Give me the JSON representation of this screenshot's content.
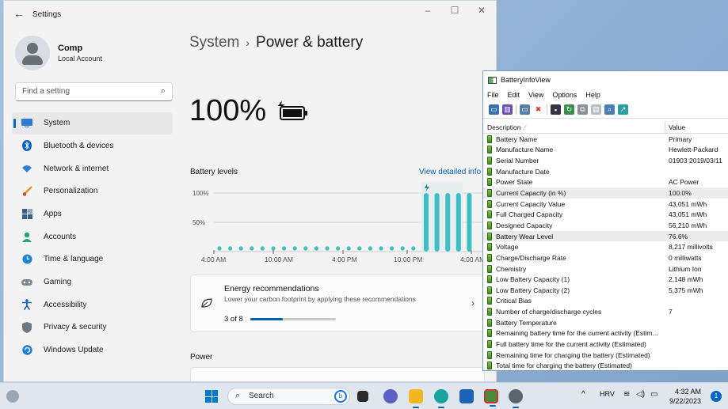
{
  "settings": {
    "window_title": "Settings",
    "profile": {
      "name": "Comp",
      "subtitle": "Local Account"
    },
    "search_placeholder": "Find a setting",
    "nav": [
      {
        "label": "System",
        "icon": "monitor-icon",
        "active": true
      },
      {
        "label": "Bluetooth & devices",
        "icon": "bluetooth-icon"
      },
      {
        "label": "Network & internet",
        "icon": "wifi-icon"
      },
      {
        "label": "Personalization",
        "icon": "brush-icon"
      },
      {
        "label": "Apps",
        "icon": "apps-icon"
      },
      {
        "label": "Accounts",
        "icon": "person-icon"
      },
      {
        "label": "Time & language",
        "icon": "globe-clock-icon"
      },
      {
        "label": "Gaming",
        "icon": "gamepad-icon"
      },
      {
        "label": "Accessibility",
        "icon": "accessibility-icon"
      },
      {
        "label": "Privacy & security",
        "icon": "shield-icon"
      },
      {
        "label": "Windows Update",
        "icon": "update-icon"
      }
    ],
    "breadcrumb": {
      "parent": "System",
      "sep": "›",
      "current": "Power & battery"
    },
    "battery_percent": "100%",
    "battery_levels_label": "Battery levels",
    "view_detailed_info": "View detailed info",
    "energy_card": {
      "title": "Energy recommendations",
      "subtitle": "Lower your carbon footprint by applying these recommendations",
      "count": "3 of 8",
      "progress": 0.375
    },
    "power_label": "Power"
  },
  "chart_data": {
    "type": "bar",
    "y_ticks": [
      "100%",
      "50%"
    ],
    "x_labels": [
      "4:00 AM",
      "10:00 AM",
      "4:00 PM",
      "10:00 PM",
      "4:00 AM"
    ],
    "series": [
      {
        "values": [
          100,
          100,
          100,
          100,
          100
        ]
      }
    ],
    "ylim": [
      0,
      100
    ]
  },
  "biv": {
    "title": "BatteryInfoView",
    "menu": [
      "File",
      "Edit",
      "View",
      "Options",
      "Help"
    ],
    "col_description": "Description",
    "col_value": "Value",
    "rows": [
      {
        "d": "Battery Name",
        "v": "Primary"
      },
      {
        "d": "Manufacture Name",
        "v": "Hewlett-Packard"
      },
      {
        "d": "Serial Number",
        "v": "01903 2019/03/11"
      },
      {
        "d": "Manufacture Date",
        "v": ""
      },
      {
        "d": "Power State",
        "v": "AC Power"
      },
      {
        "d": "Current Capacity (in %)",
        "v": "100.0%",
        "hl": true
      },
      {
        "d": "Current Capacity Value",
        "v": "43,051 mWh"
      },
      {
        "d": "Full Charged Capacity",
        "v": "43,051 mWh"
      },
      {
        "d": "Designed Capacity",
        "v": "56,210 mWh"
      },
      {
        "d": "Battery Wear Level",
        "v": "76.6%",
        "hl": true
      },
      {
        "d": "Voltage",
        "v": "8,217 millivolts"
      },
      {
        "d": "Charge/Discharge Rate",
        "v": "0 milliwatts"
      },
      {
        "d": "Chemistry",
        "v": "Lithium Ion"
      },
      {
        "d": "Low Battery Capacity (1)",
        "v": "2,148 mWh"
      },
      {
        "d": "Low Battery Capacity (2)",
        "v": "5,375 mWh"
      },
      {
        "d": "Critical Bias",
        "v": ""
      },
      {
        "d": "Number of charge/discharge cycles",
        "v": "7"
      },
      {
        "d": "Battery Temperature",
        "v": ""
      },
      {
        "d": "Remaining battery time for the current activity (Estim...",
        "v": ""
      },
      {
        "d": "Full battery time for the current activity (Estimated)",
        "v": ""
      },
      {
        "d": "Remaining time for charging the battery (Estimated)",
        "v": ""
      },
      {
        "d": "Total  time for charging the battery (Estimated)",
        "v": ""
      }
    ]
  },
  "taskbar": {
    "search_label": "Search",
    "language": "HRV",
    "time": "4:32 AM",
    "date": "9/22/2023",
    "notifications": "1"
  },
  "colors": {
    "accent": "#0067c0",
    "bar": "#3fbfc3"
  }
}
